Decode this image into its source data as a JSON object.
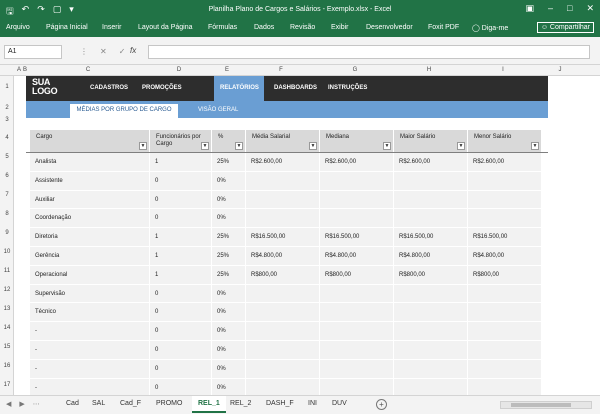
{
  "titlebar": {
    "title": "Planilha Plano de Cargos e Salários - Exemplo.xlsx  -  Excel",
    "qat": [
      "save-icon",
      "undo-icon",
      "redo-icon",
      "print-preview-icon",
      "customize-icon"
    ]
  },
  "ribbon": {
    "tabs": [
      "Arquivo",
      "Página Inicial",
      "Inserir",
      "Layout da Página",
      "Fórmulas",
      "Dados",
      "Revisão",
      "Exibir",
      "Desenvolvedor",
      "Foxit PDF"
    ],
    "tell_me": "Diga-me",
    "share": "Compartilhar"
  },
  "formula_bar": {
    "name_box": "A1",
    "fx": "fx",
    "value": ""
  },
  "columns": [
    "A",
    "B",
    "C",
    "D",
    "E",
    "F",
    "G",
    "H",
    "I",
    "J"
  ],
  "rows": [
    "1",
    "2",
    "3",
    "4",
    "5",
    "6",
    "7",
    "8",
    "9",
    "10",
    "11",
    "12",
    "13",
    "14",
    "15",
    "16",
    "17"
  ],
  "dashboard": {
    "logo_line1": "SUA",
    "logo_line2": "LOGO",
    "nav": [
      "CADASTROS",
      "PROMOÇÕES",
      "RELATÓRIOS",
      "DASHBOARDS",
      "INSTRUÇÕES"
    ],
    "subtabs": [
      "MÉDIAS POR GRUPO DE CARGO",
      "VISÃO GERAL"
    ]
  },
  "table": {
    "headers": [
      "Cargo",
      "Funcionários por Cargo",
      "%",
      "Média Salarial",
      "Mediana",
      "Maior Salário",
      "Menor Salário"
    ],
    "rows": [
      [
        "Analista",
        "1",
        "25%",
        "R$2.600,00",
        "R$2.600,00",
        "R$2.600,00",
        "R$2.600,00"
      ],
      [
        "Assistente",
        "0",
        "0%",
        "",
        "",
        "",
        ""
      ],
      [
        "Auxiliar",
        "0",
        "0%",
        "",
        "",
        "",
        ""
      ],
      [
        "Coordenação",
        "0",
        "0%",
        "",
        "",
        "",
        ""
      ],
      [
        "Diretoria",
        "1",
        "25%",
        "R$16.500,00",
        "R$16.500,00",
        "R$16.500,00",
        "R$16.500,00"
      ],
      [
        "Gerência",
        "1",
        "25%",
        "R$4.800,00",
        "R$4.800,00",
        "R$4.800,00",
        "R$4.800,00"
      ],
      [
        "Operacional",
        "1",
        "25%",
        "R$800,00",
        "R$800,00",
        "R$800,00",
        "R$800,00"
      ],
      [
        "Supervisão",
        "0",
        "0%",
        "",
        "",
        "",
        ""
      ],
      [
        "Técnico",
        "0",
        "0%",
        "",
        "",
        "",
        ""
      ],
      [
        "-",
        "0",
        "0%",
        "",
        "",
        "",
        ""
      ],
      [
        "-",
        "0",
        "0%",
        "",
        "",
        "",
        ""
      ],
      [
        "-",
        "0",
        "0%",
        "",
        "",
        "",
        ""
      ],
      [
        "-",
        "0",
        "0%",
        "",
        "",
        "",
        ""
      ]
    ]
  },
  "sheets": {
    "tabs": [
      "Cad",
      "SAL",
      "Cad_F",
      "PROMO",
      "REL_1",
      "REL_2",
      "DASH_F",
      "INI",
      "DUV"
    ],
    "active": "REL_1"
  },
  "colors": {
    "excel_green": "#217346",
    "nav_dark": "#2d2d2d",
    "accent_blue": "#6a9ed3",
    "cell_gray": "#f2f2f2",
    "header_gray": "#d9d9d9"
  }
}
